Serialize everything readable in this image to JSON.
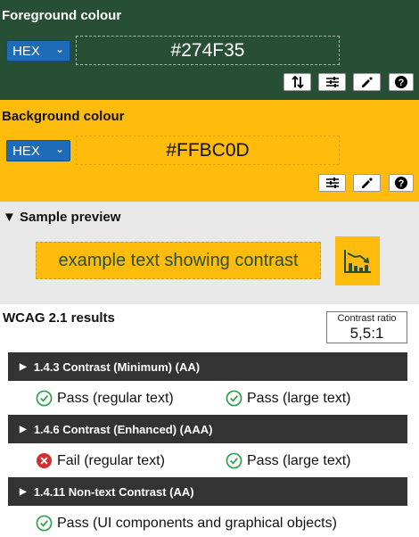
{
  "foreground": {
    "title": "Foreground colour",
    "format": "HEX",
    "value": "#274F35",
    "color": "#274F35"
  },
  "background": {
    "title": "Background colour",
    "format": "HEX",
    "value": "#FFBC0D",
    "color": "#FFBC0D"
  },
  "preview": {
    "title": "Sample preview",
    "sample_text": "example text showing contrast"
  },
  "wcag": {
    "title": "WCAG 2.1 results",
    "ratio_label": "Contrast ratio",
    "ratio_value": "5,5:1",
    "criteria": [
      {
        "label": "1.4.3 Contrast (Minimum) (AA)",
        "results": [
          {
            "status": "pass",
            "text": "Pass (regular text)"
          },
          {
            "status": "pass",
            "text": "Pass (large text)"
          }
        ]
      },
      {
        "label": "1.4.6 Contrast (Enhanced) (AAA)",
        "results": [
          {
            "status": "fail",
            "text": "Fail (regular text)"
          },
          {
            "status": "pass",
            "text": "Pass (large text)"
          }
        ]
      },
      {
        "label": "1.4.11 Non-text Contrast (AA)",
        "results": [
          {
            "status": "pass",
            "text": "Pass (UI components and graphical objects)"
          }
        ]
      }
    ]
  },
  "icons": {
    "swap": "swap-arrows-icon",
    "adjust": "sliders-icon",
    "eyedropper": "eyedropper-icon",
    "help": "help-icon",
    "pass": "check-circle-icon",
    "fail": "x-circle-icon",
    "graph": "chart-icon"
  },
  "colors": {
    "pass": "#2e9e4f",
    "fail": "#d32f2f",
    "select": "#1E6BB8",
    "dark_bar": "#333333"
  }
}
